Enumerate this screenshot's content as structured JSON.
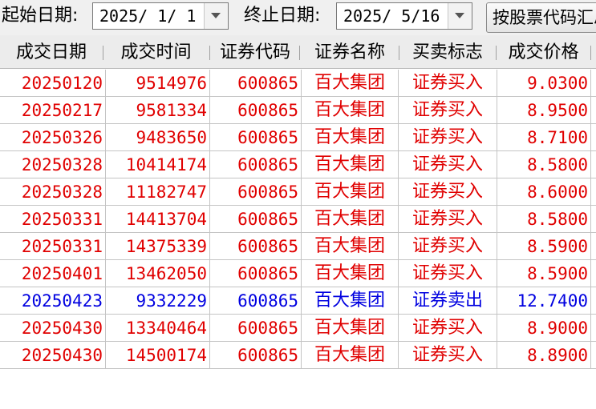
{
  "toolbar": {
    "start_label": "起始日期:",
    "start_value": "2025/ 1/ 1",
    "end_label": "终止日期:",
    "end_value": "2025/ 5/16",
    "query_button": "按股票代码汇总"
  },
  "table": {
    "headers": [
      "成交日期",
      "成交时间",
      "证券代码",
      "证券名称",
      "买卖标志",
      "成交价格"
    ],
    "colors": {
      "buy": "#e00000",
      "sell": "#0000e0"
    },
    "rows": [
      {
        "date": "20250120",
        "time": "9514976",
        "code": "600865",
        "name": "百大集团",
        "side": "证券买入",
        "price": "9.0300",
        "type": "buy"
      },
      {
        "date": "20250217",
        "time": "9581334",
        "code": "600865",
        "name": "百大集团",
        "side": "证券买入",
        "price": "8.9500",
        "type": "buy"
      },
      {
        "date": "20250326",
        "time": "9483650",
        "code": "600865",
        "name": "百大集团",
        "side": "证券买入",
        "price": "8.7100",
        "type": "buy"
      },
      {
        "date": "20250328",
        "time": "10414174",
        "code": "600865",
        "name": "百大集团",
        "side": "证券买入",
        "price": "8.5800",
        "type": "buy"
      },
      {
        "date": "20250328",
        "time": "11182747",
        "code": "600865",
        "name": "百大集团",
        "side": "证券买入",
        "price": "8.6000",
        "type": "buy"
      },
      {
        "date": "20250331",
        "time": "14413704",
        "code": "600865",
        "name": "百大集团",
        "side": "证券买入",
        "price": "8.5800",
        "type": "buy"
      },
      {
        "date": "20250331",
        "time": "14375339",
        "code": "600865",
        "name": "百大集团",
        "side": "证券买入",
        "price": "8.5900",
        "type": "buy"
      },
      {
        "date": "20250401",
        "time": "13462050",
        "code": "600865",
        "name": "百大集团",
        "side": "证券买入",
        "price": "8.5900",
        "type": "buy"
      },
      {
        "date": "20250423",
        "time": "9332229",
        "code": "600865",
        "name": "百大集团",
        "side": "证券卖出",
        "price": "12.7400",
        "type": "sell"
      },
      {
        "date": "20250430",
        "time": "13340464",
        "code": "600865",
        "name": "百大集团",
        "side": "证券买入",
        "price": "8.9000",
        "type": "buy"
      },
      {
        "date": "20250430",
        "time": "14500174",
        "code": "600865",
        "name": "百大集团",
        "side": "证券买入",
        "price": "8.8900",
        "type": "buy"
      }
    ]
  }
}
